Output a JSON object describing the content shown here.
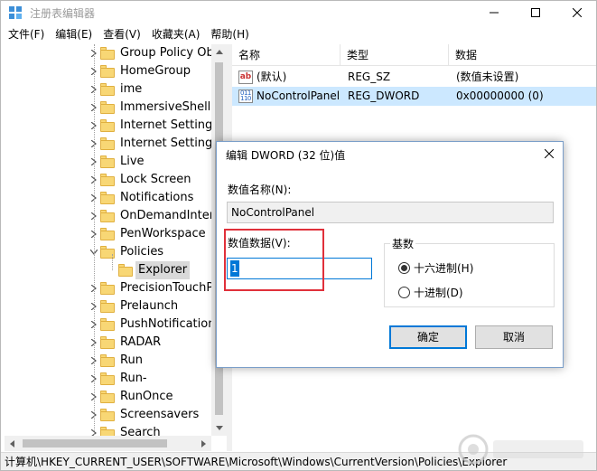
{
  "window": {
    "title": "注册表编辑器"
  },
  "menu": [
    "文件(F)",
    "编辑(E)",
    "查看(V)",
    "收藏夹(A)",
    "帮助(H)"
  ],
  "tree": {
    "items": [
      {
        "label": "Group Policy Obje",
        "expanded": false
      },
      {
        "label": "HomeGroup",
        "expanded": false
      },
      {
        "label": "ime",
        "expanded": false
      },
      {
        "label": "ImmersiveShell",
        "expanded": false
      },
      {
        "label": "Internet Settings",
        "expanded": false
      },
      {
        "label": "Internet SettingsV",
        "expanded": false
      },
      {
        "label": "Live",
        "expanded": false
      },
      {
        "label": "Lock Screen",
        "expanded": false
      },
      {
        "label": "Notifications",
        "expanded": false
      },
      {
        "label": "OnDemandInterfa",
        "expanded": false
      },
      {
        "label": "PenWorkspace",
        "expanded": false
      },
      {
        "label": "Policies",
        "expanded": true
      },
      {
        "label": "Explorer",
        "child": true,
        "selected": true
      },
      {
        "label": "PrecisionTouchPa",
        "expanded": false
      },
      {
        "label": "Prelaunch",
        "expanded": false
      },
      {
        "label": "PushNotifications",
        "expanded": false
      },
      {
        "label": "RADAR",
        "expanded": false
      },
      {
        "label": "Run",
        "expanded": false
      },
      {
        "label": "Run-",
        "expanded": false
      },
      {
        "label": "RunOnce",
        "expanded": false
      },
      {
        "label": "Screensavers",
        "expanded": false
      },
      {
        "label": "Search",
        "expanded": false
      }
    ]
  },
  "list": {
    "headers": [
      "名称",
      "类型",
      "数据"
    ],
    "rows": [
      {
        "icon": "reg-sz-icon",
        "name": "(默认)",
        "type": "REG_SZ",
        "data": "(数值未设置)",
        "selected": false
      },
      {
        "icon": "reg-dword-icon",
        "name": "NoControlPanel",
        "type": "REG_DWORD",
        "data": "0x00000000 (0)",
        "selected": true
      }
    ]
  },
  "status": {
    "path": "计算机\\HKEY_CURRENT_USER\\SOFTWARE\\Microsoft\\Windows\\CurrentVersion\\Policies\\Explorer"
  },
  "dialog": {
    "title": "编辑 DWORD (32 位)值",
    "name_label": "数值名称(N):",
    "name_value": "NoControlPanel",
    "data_label": "数值数据(V):",
    "data_value": "1",
    "base_label": "基数",
    "base_options": [
      {
        "label": "十六进制(H)",
        "checked": true
      },
      {
        "label": "十进制(D)",
        "checked": false
      }
    ],
    "ok_label": "确定",
    "cancel_label": "取消"
  },
  "colors": {
    "selection": "#cce8ff",
    "accent": "#0078d7",
    "highlight_box": "#e0303a",
    "folder": "#f8d775"
  }
}
